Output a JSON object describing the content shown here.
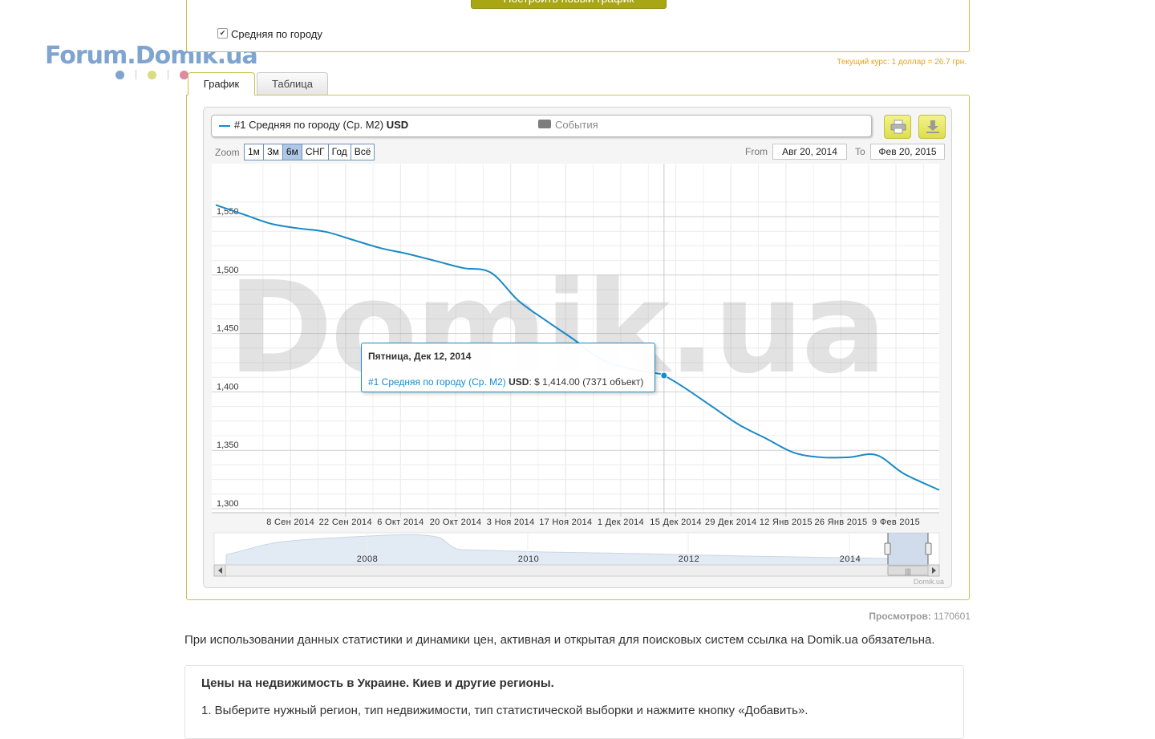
{
  "logo": {
    "text": "Forum.Domik.ua",
    "dot_colors": [
      "#7ea4cf",
      "#d6dd82",
      "#dc8aa0"
    ]
  },
  "form": {
    "build_button": "Построить новый график",
    "checkbox_label": "Средняя по городу",
    "checkbox_checked": true
  },
  "rate_text": "Текущий курс: 1 доллар = 26.7 грн.",
  "tabs": [
    {
      "label": "График",
      "active": true
    },
    {
      "label": "Таблица",
      "active": false
    }
  ],
  "legend": {
    "series_label": "#1 Средняя по городу (Ср. М2)",
    "series_unit": "USD",
    "events_label": "События"
  },
  "zoom": {
    "label": "Zoom",
    "buttons": [
      "1м",
      "3м",
      "6м",
      "СНГ",
      "Год",
      "Всё"
    ],
    "selected": "6м"
  },
  "range": {
    "from_label": "From",
    "from_value": "Авг 20, 2014",
    "to_label": "To",
    "to_value": "Фев 20, 2015"
  },
  "watermark": "Domik.ua",
  "tooltip": {
    "title": "Пятница, Дек 12, 2014",
    "series": "#1 Средняя по городу (Ср. М2)",
    "unit": "USD",
    "value_text": ": $ 1,414.00 (7371 объект)"
  },
  "navigator": {
    "year_labels": [
      "2008",
      "2010",
      "2012",
      "2014"
    ],
    "credit": "Domik.ua"
  },
  "colors": {
    "series": "#1a8ac6",
    "accent_border": "#c8c44a",
    "rate": "#e8a21d"
  },
  "chart_data": {
    "type": "line",
    "title": "",
    "xlabel": "",
    "ylabel": "",
    "series": [
      {
        "name": "#1 Средняя по городу (Ср. М2) USD",
        "x": [
          "2014-08-20",
          "2014-08-27",
          "2014-09-03",
          "2014-09-10",
          "2014-09-17",
          "2014-09-24",
          "2014-10-01",
          "2014-10-08",
          "2014-10-15",
          "2014-10-22",
          "2014-10-29",
          "2014-11-05",
          "2014-11-12",
          "2014-11-19",
          "2014-11-26",
          "2014-12-03",
          "2014-12-10",
          "2014-12-12",
          "2014-12-17",
          "2014-12-24",
          "2014-12-31",
          "2015-01-07",
          "2015-01-14",
          "2015-01-21",
          "2015-01-28",
          "2015-02-04",
          "2015-02-11",
          "2015-02-20"
        ],
        "values": [
          1560,
          1552,
          1544,
          1540,
          1537,
          1530,
          1523,
          1518,
          1512,
          1506,
          1502,
          1478,
          1461,
          1445,
          1428,
          1420,
          1416,
          1414,
          1404,
          1388,
          1372,
          1360,
          1348,
          1344,
          1344,
          1346,
          1330,
          1316
        ]
      }
    ],
    "ylim": [
      1300,
      1570
    ],
    "y_ticks": [
      1300,
      1350,
      1400,
      1450,
      1500,
      1550
    ],
    "y_tick_labels": [
      "1,300",
      "1,350",
      "1,400",
      "1,450",
      "1,500",
      "1,550"
    ],
    "x_ticks": [
      "2014-09-08",
      "2014-09-22",
      "2014-10-06",
      "2014-10-20",
      "2014-11-03",
      "2014-11-17",
      "2014-12-01",
      "2014-12-15",
      "2014-12-29",
      "2015-01-12",
      "2015-01-26",
      "2015-02-09"
    ],
    "x_tick_labels": [
      "8 Сен 2014",
      "22 Сен 2014",
      "6 Окт 2014",
      "20 Окт 2014",
      "3 Ноя 2014",
      "17 Ноя 2014",
      "1 Дек 2014",
      "15 Дек 2014",
      "29 Дек 2014",
      "12 Янв 2015",
      "26 Янв 2015",
      "9 Фев 2015"
    ],
    "x_range": [
      "2014-08-20",
      "2015-02-20"
    ],
    "highlight": {
      "x": "2014-12-12",
      "y": 1414
    },
    "grid": true,
    "legend": "top"
  },
  "footer": {
    "views_label": "Просмотров:",
    "views_value": "1170601",
    "notice": "При использовании данных статистики и динамики цен, активная и открытая для поисковых систем ссылка на Domik.ua обязательна.",
    "info_title": "Цены на недвижимость в Украине. Киев и другие регионы.",
    "info_text": "1. Выберите нужный регион, тип недвижимости, тип статистической выборки и нажмите кнопку «Добавить»."
  }
}
